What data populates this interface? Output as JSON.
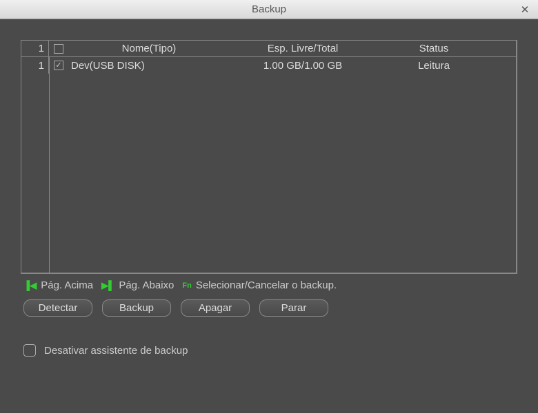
{
  "window": {
    "title": "Backup"
  },
  "table": {
    "headers": {
      "num": "1",
      "name": "Nome(Tipo)",
      "space": "Esp. Livre/Total",
      "status": "Status"
    },
    "rows": [
      {
        "num": "1",
        "checked": true,
        "name": "Dev(USB DISK)",
        "space": "1.00 GB/1.00 GB",
        "status": "Leitura"
      }
    ]
  },
  "hints": {
    "page_up": "Pág. Acima",
    "page_down": "Pág. Abaixo",
    "select": "Selecionar/Cancelar o backup."
  },
  "buttons": {
    "detect": "Detectar",
    "backup": "Backup",
    "erase": "Apagar",
    "stop": "Parar"
  },
  "footer": {
    "disable_wizard": "Desativar assistente de backup"
  }
}
